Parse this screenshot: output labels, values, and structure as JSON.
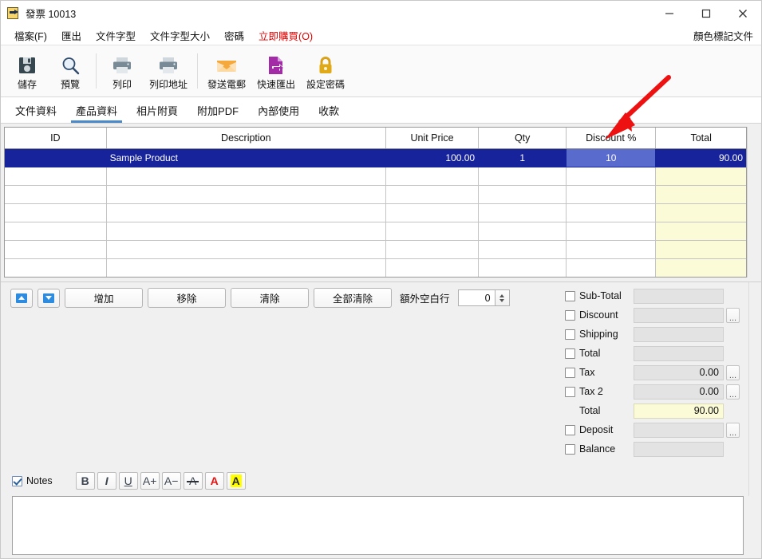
{
  "window": {
    "title": "發票 10013",
    "icon": "document-export-icon",
    "minimize": "—",
    "maximize": "□",
    "close": "✕"
  },
  "menubar": {
    "items": [
      {
        "label": "檔案(F)",
        "accent": false
      },
      {
        "label": "匯出",
        "accent": false
      },
      {
        "label": "文件字型",
        "accent": false
      },
      {
        "label": "文件字型大小",
        "accent": false
      },
      {
        "label": "密碼",
        "accent": false
      },
      {
        "label": "立即購買(O)",
        "accent": true
      }
    ],
    "right_label": "顏色標記文件"
  },
  "toolbar": {
    "buttons": [
      {
        "label": "儲存",
        "icon": "save-floppy-icon"
      },
      {
        "label": "預覽",
        "icon": "magnifier-icon"
      },
      {
        "label": "列印",
        "icon": "printer-icon"
      },
      {
        "label": "列印地址",
        "icon": "printer-address-icon"
      },
      {
        "label": "發送電郵",
        "icon": "envelope-icon"
      },
      {
        "label": "快速匯出",
        "icon": "export-document-icon"
      },
      {
        "label": "設定密碼",
        "icon": "padlock-icon"
      }
    ]
  },
  "tabs": {
    "items": [
      {
        "label": "文件資料",
        "active": false
      },
      {
        "label": "產品資料",
        "active": true
      },
      {
        "label": "相片附頁",
        "active": false
      },
      {
        "label": "附加PDF",
        "active": false
      },
      {
        "label": "內部使用",
        "active": false
      },
      {
        "label": "收款",
        "active": false
      }
    ]
  },
  "grid": {
    "columns": [
      "ID",
      "Description",
      "Unit Price",
      "Qty",
      "Discount %",
      "Total"
    ],
    "rows": [
      {
        "selected": true,
        "id": "",
        "description": "Sample Product",
        "unit_price": "100.00",
        "qty": "1",
        "discount": "10",
        "total": "90.00"
      },
      {
        "selected": false,
        "id": "",
        "description": "",
        "unit_price": "",
        "qty": "",
        "discount": "",
        "total": ""
      },
      {
        "selected": false,
        "id": "",
        "description": "",
        "unit_price": "",
        "qty": "",
        "discount": "",
        "total": ""
      },
      {
        "selected": false,
        "id": "",
        "description": "",
        "unit_price": "",
        "qty": "",
        "discount": "",
        "total": ""
      },
      {
        "selected": false,
        "id": "",
        "description": "",
        "unit_price": "",
        "qty": "",
        "discount": "",
        "total": ""
      },
      {
        "selected": false,
        "id": "",
        "description": "",
        "unit_price": "",
        "qty": "",
        "discount": "",
        "total": ""
      },
      {
        "selected": false,
        "id": "",
        "description": "",
        "unit_price": "",
        "qty": "",
        "discount": "",
        "total": ""
      },
      {
        "selected": false,
        "id": "",
        "description": "",
        "unit_price": "",
        "qty": "",
        "discount": "",
        "total": ""
      }
    ]
  },
  "rowtools": {
    "move_up": "move-up",
    "move_down": "move-down",
    "add": "增加",
    "remove": "移除",
    "clear": "清除",
    "clear_all": "全部清除",
    "extra_blank_label": "額外空白行",
    "extra_blank_value": "0"
  },
  "totals": {
    "rows": [
      {
        "label": "Sub-Total",
        "value": "",
        "checkbox": true,
        "dots": false,
        "highlight": false
      },
      {
        "label": "Discount",
        "value": "",
        "checkbox": true,
        "dots": true,
        "highlight": false
      },
      {
        "label": "Shipping",
        "value": "",
        "checkbox": true,
        "dots": false,
        "highlight": false
      },
      {
        "label": "Total",
        "value": "",
        "checkbox": true,
        "dots": false,
        "highlight": false
      },
      {
        "label": "Tax",
        "value": "0.00",
        "checkbox": true,
        "dots": true,
        "highlight": false
      },
      {
        "label": "Tax 2",
        "value": "0.00",
        "checkbox": true,
        "dots": true,
        "highlight": false
      },
      {
        "label": "Total",
        "value": "90.00",
        "checkbox": false,
        "dots": false,
        "highlight": true
      },
      {
        "label": "Deposit",
        "value": "",
        "checkbox": true,
        "dots": true,
        "highlight": false
      },
      {
        "label": "Balance",
        "value": "",
        "checkbox": true,
        "dots": false,
        "highlight": false
      }
    ]
  },
  "notes": {
    "checkbox_label": "Notes",
    "checked": true,
    "content": "",
    "format_buttons": [
      {
        "name": "bold",
        "glyph": "B"
      },
      {
        "name": "italic",
        "glyph": "I"
      },
      {
        "name": "underline",
        "glyph": "U"
      },
      {
        "name": "font-increase",
        "glyph": "A+"
      },
      {
        "name": "font-decrease",
        "glyph": "A−"
      },
      {
        "name": "strikethrough",
        "glyph": "A"
      },
      {
        "name": "font-color",
        "glyph": "A"
      },
      {
        "name": "highlight-color",
        "glyph": "A"
      }
    ]
  },
  "annotation": {
    "type": "red-arrow",
    "points_to": "Discount %",
    "color": "#ee1111"
  }
}
